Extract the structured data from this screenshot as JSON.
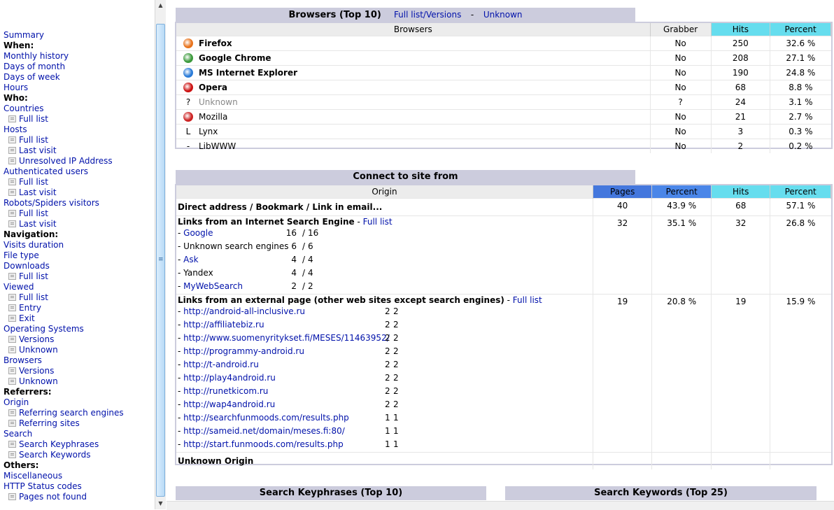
{
  "menu": [
    {
      "type": "itm",
      "label": "Summary"
    },
    {
      "type": "sec",
      "label": "When:"
    },
    {
      "type": "itm",
      "label": "Monthly history"
    },
    {
      "type": "itm",
      "label": "Days of month"
    },
    {
      "type": "itm",
      "label": "Days of week"
    },
    {
      "type": "itm",
      "label": "Hours"
    },
    {
      "type": "sec",
      "label": "Who:"
    },
    {
      "type": "itm",
      "label": "Countries"
    },
    {
      "type": "sub",
      "label": "Full list"
    },
    {
      "type": "itm",
      "label": "Hosts"
    },
    {
      "type": "sub",
      "label": "Full list"
    },
    {
      "type": "sub",
      "label": "Last visit"
    },
    {
      "type": "sub",
      "label": "Unresolved IP Address"
    },
    {
      "type": "itm",
      "label": "Authenticated users"
    },
    {
      "type": "sub",
      "label": "Full list"
    },
    {
      "type": "sub",
      "label": "Last visit"
    },
    {
      "type": "itm",
      "label": "Robots/Spiders visitors"
    },
    {
      "type": "sub",
      "label": "Full list"
    },
    {
      "type": "sub",
      "label": "Last visit"
    },
    {
      "type": "sec",
      "label": "Navigation:"
    },
    {
      "type": "itm",
      "label": "Visits duration"
    },
    {
      "type": "itm",
      "label": "File type"
    },
    {
      "type": "itm",
      "label": "Downloads"
    },
    {
      "type": "sub",
      "label": "Full list"
    },
    {
      "type": "itm",
      "label": "Viewed"
    },
    {
      "type": "sub",
      "label": "Full list"
    },
    {
      "type": "sub",
      "label": "Entry"
    },
    {
      "type": "sub",
      "label": "Exit"
    },
    {
      "type": "itm",
      "label": "Operating Systems"
    },
    {
      "type": "sub",
      "label": "Versions"
    },
    {
      "type": "sub",
      "label": "Unknown"
    },
    {
      "type": "itm",
      "label": "Browsers"
    },
    {
      "type": "sub",
      "label": "Versions"
    },
    {
      "type": "sub",
      "label": "Unknown"
    },
    {
      "type": "sec",
      "label": "Referrers:"
    },
    {
      "type": "itm",
      "label": "Origin"
    },
    {
      "type": "sub",
      "label": "Referring search engines"
    },
    {
      "type": "sub",
      "label": "Referring sites"
    },
    {
      "type": "itm",
      "label": "Search"
    },
    {
      "type": "sub",
      "label": "Search Keyphrases"
    },
    {
      "type": "sub",
      "label": "Search Keywords"
    },
    {
      "type": "sec",
      "label": "Others:"
    },
    {
      "type": "itm",
      "label": "Miscellaneous"
    },
    {
      "type": "itm",
      "label": "HTTP Status codes"
    },
    {
      "type": "sub",
      "label": "Pages not found"
    }
  ],
  "browsers": {
    "title": "Browsers (Top 10)",
    "link_full": "Full list/Versions",
    "sep": "-",
    "link_unknown": "Unknown",
    "headers": [
      "Browsers",
      "Grabber",
      "Hits",
      "Percent"
    ],
    "rows": [
      {
        "name": "Firefox",
        "bold": true,
        "icon": "firefox-icon",
        "color": "#e8731c",
        "grabber": "No",
        "hits": "250",
        "pct": "32.6 %"
      },
      {
        "name": "Google Chrome",
        "bold": true,
        "icon": "chrome-icon",
        "color": "#3c9a3c",
        "grabber": "No",
        "hits": "208",
        "pct": "27.1 %"
      },
      {
        "name": "MS Internet Explorer",
        "bold": true,
        "icon": "ie-icon",
        "color": "#2a7bd8",
        "grabber": "No",
        "hits": "190",
        "pct": "24.8 %"
      },
      {
        "name": "Opera",
        "bold": true,
        "icon": "opera-icon",
        "color": "#cc1111",
        "grabber": "No",
        "hits": "68",
        "pct": "8.8 %"
      },
      {
        "name": "Unknown",
        "grey": true,
        "icon": "question-icon",
        "glyph": "?",
        "grabber": "?",
        "hits": "24",
        "pct": "3.1 %"
      },
      {
        "name": "Mozilla",
        "icon": "mozilla-icon",
        "color": "#cc2222",
        "grabber": "No",
        "hits": "21",
        "pct": "2.7 %"
      },
      {
        "name": "Lynx",
        "icon": "lynx-icon",
        "glyph": "L",
        "grabber": "No",
        "hits": "3",
        "pct": "0.3 %"
      },
      {
        "name": "LibWWW",
        "icon": "dash-icon",
        "glyph": "-",
        "grabber": "No",
        "hits": "2",
        "pct": "0.2 %"
      }
    ]
  },
  "origin": {
    "title": "Connect to site from",
    "headers": [
      "Origin",
      "Pages",
      "Percent",
      "Hits",
      "Percent"
    ],
    "direct": {
      "label": "Direct address / Bookmark / Link in email...",
      "pages": "40",
      "ppct": "43.9 %",
      "hits": "68",
      "hpct": "57.1 %"
    },
    "search": {
      "label": "Links from an Internet Search Engine",
      "link": "Full list",
      "pages": "32",
      "ppct": "35.1 %",
      "hits": "32",
      "hpct": "26.8 %",
      "items": [
        {
          "name": "Google",
          "link": true,
          "a": "16",
          "b": "16"
        },
        {
          "name": "Unknown search engines",
          "link": false,
          "a": "6",
          "b": "6"
        },
        {
          "name": "Ask",
          "link": true,
          "a": "4",
          "b": "4"
        },
        {
          "name": "Yandex",
          "link": false,
          "a": "4",
          "b": "4"
        },
        {
          "name": "MyWebSearch",
          "link": true,
          "a": "2",
          "b": "2"
        }
      ]
    },
    "external": {
      "label": "Links from an external page (other web sites except search engines)",
      "link": "Full list",
      "pages": "19",
      "ppct": "20.8 %",
      "hits": "19",
      "hpct": "15.9 %",
      "items": [
        {
          "url": "http://android-all-inclusive.ru",
          "a": "2",
          "b": "2"
        },
        {
          "url": "http://affiliatebiz.ru",
          "a": "2",
          "b": "2"
        },
        {
          "url": "http://www.suomenyritykset.fi/MESES/11463952/",
          "a": "2",
          "b": "2"
        },
        {
          "url": "http://programmy-android.ru",
          "a": "2",
          "b": "2"
        },
        {
          "url": "http://t-android.ru",
          "a": "2",
          "b": "2"
        },
        {
          "url": "http://play4android.ru",
          "a": "2",
          "b": "2"
        },
        {
          "url": "http://runetkicom.ru",
          "a": "2",
          "b": "2"
        },
        {
          "url": "http://wap4android.ru",
          "a": "2",
          "b": "2"
        },
        {
          "url": "http://searchfunmoods.com/results.php",
          "a": "1",
          "b": "1"
        },
        {
          "url": "http://sameid.net/domain/meses.fi:80/",
          "a": "1",
          "b": "1"
        },
        {
          "url": "http://start.funmoods.com/results.php",
          "a": "1",
          "b": "1"
        }
      ]
    },
    "unknown": {
      "label": "Unknown Origin"
    }
  },
  "keyphrases": {
    "title": "Search Keyphrases (Top 10)"
  },
  "keywords": {
    "title": "Search Keywords (Top 25)"
  },
  "list_dash": "- "
}
